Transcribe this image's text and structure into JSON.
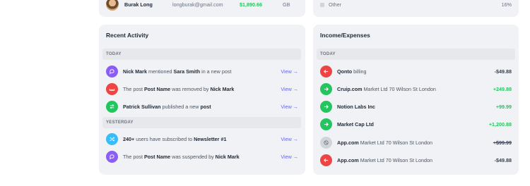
{
  "top_user": {
    "name": "Burak Long",
    "email": "longburak@gmail.com",
    "amount": "$1,890.66",
    "country": "GB"
  },
  "top_other": {
    "label": "Other",
    "percent": "16%"
  },
  "activity": {
    "title": "Recent Activity",
    "today_label": "TODAY",
    "yesterday_label": "YESTERDAY",
    "view_label": "View →",
    "items": [
      {
        "icon": "chat-icon",
        "color": "#8b5cf6",
        "parts": [
          {
            "b": "Nick Mark"
          },
          {
            "t": " mentioned "
          },
          {
            "b": "Sara Smith"
          },
          {
            "t": " in a new post"
          }
        ]
      },
      {
        "icon": "removed-icon",
        "color": "#ef4444",
        "parts": [
          {
            "t": "The post "
          },
          {
            "b": "Post Name"
          },
          {
            "t": " was removed by "
          },
          {
            "b": "Nick Mark"
          }
        ]
      },
      {
        "icon": "swap-icon",
        "color": "#22c55e",
        "parts": [
          {
            "b": "Patrick Sullivan"
          },
          {
            "t": " published a new "
          },
          {
            "b": "post"
          }
        ]
      },
      {
        "icon": "shuffle-icon",
        "color": "#38bdf8",
        "parts": [
          {
            "b": "240+"
          },
          {
            "t": " users have subscribed to "
          },
          {
            "b": "Newsletter #1"
          }
        ]
      },
      {
        "icon": "chat-icon",
        "color": "#8b5cf6",
        "parts": [
          {
            "t": "The post "
          },
          {
            "b": "Post Name"
          },
          {
            "t": " was suspended by "
          },
          {
            "b": "Nick Mark"
          }
        ]
      }
    ]
  },
  "income": {
    "title": "Income/Expenses",
    "today_label": "TODAY",
    "items": [
      {
        "icon": "arrow-left-icon",
        "color": "#ef4444",
        "name": "Qonto",
        "detail": " billing",
        "amount": "-$49.88",
        "kind": "neg"
      },
      {
        "icon": "arrow-right-icon",
        "color": "#22c55e",
        "name": "Cruip.com",
        "detail": " Market Ltd 70 Wilson St London",
        "amount": "+249.88",
        "kind": "pos"
      },
      {
        "icon": "arrow-right-icon",
        "color": "#22c55e",
        "name": "Notion Labs Inc",
        "detail": "",
        "amount": "+99.99",
        "kind": "pos"
      },
      {
        "icon": "arrow-right-icon",
        "color": "#22c55e",
        "name": "Market Cap Ltd",
        "detail": "",
        "amount": "+1,200.88",
        "kind": "pos"
      },
      {
        "icon": "cancel-icon",
        "color": "#d1d5db",
        "name": "App.com",
        "detail": " Market Ltd 70 Wilson St London",
        "amount": "+$99.99",
        "kind": "void"
      },
      {
        "icon": "arrow-left-icon",
        "color": "#ef4444",
        "name": "App.com",
        "detail": " Market Ltd 70 Wilson St London",
        "amount": "-$49.88",
        "kind": "neg"
      }
    ]
  }
}
